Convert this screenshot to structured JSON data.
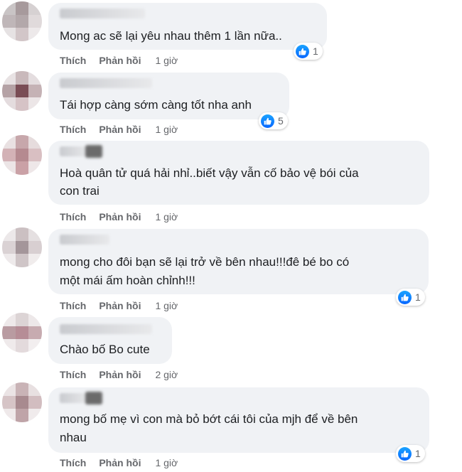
{
  "colors": {
    "bubble": "#f0f2f5",
    "meta": "#65676b",
    "like_blue": "#0866ff"
  },
  "icons": {
    "reaction": "like-thumb-icon"
  },
  "comments": [
    {
      "text_lines": [
        "Mong ac sẽ lại yêu nhau thêm 1 lần nữa.."
      ],
      "like_label": "Thích",
      "reply_label": "Phản hồi",
      "time": "1 giờ",
      "reaction_count": "1"
    },
    {
      "text_lines": [
        "Tái hợp càng sớm càng tốt nha anh"
      ],
      "like_label": "Thích",
      "reply_label": "Phản hồi",
      "time": "1 giờ",
      "reaction_count": "5"
    },
    {
      "text_lines": [
        "Hoà quân tử quá hải nhỉ..biết vậy vẫn cố bảo vệ bói của",
        "con trai"
      ],
      "like_label": "Thích",
      "reply_label": "Phản hồi",
      "time": "1 giờ",
      "reaction_count": ""
    },
    {
      "text_lines": [
        "mong cho đôi bạn sẽ lại trở về bên nhau!!!đê bé bo có",
        "một mái ấm hoàn chỉnh!!!"
      ],
      "like_label": "Thích",
      "reply_label": "Phản hồi",
      "time": "1 giờ",
      "reaction_count": "1"
    },
    {
      "text_lines": [
        "Chào bố Bo cute"
      ],
      "like_label": "Thích",
      "reply_label": "Phản hồi",
      "time": "2 giờ",
      "reaction_count": ""
    },
    {
      "text_lines": [
        "mong bố mẹ vì con mà bỏ bớt cái tôi của mjh để về bên",
        "nhau"
      ],
      "like_label": "Thích",
      "reply_label": "Phản hồi",
      "time": "1 giờ",
      "reaction_count": "1"
    }
  ]
}
